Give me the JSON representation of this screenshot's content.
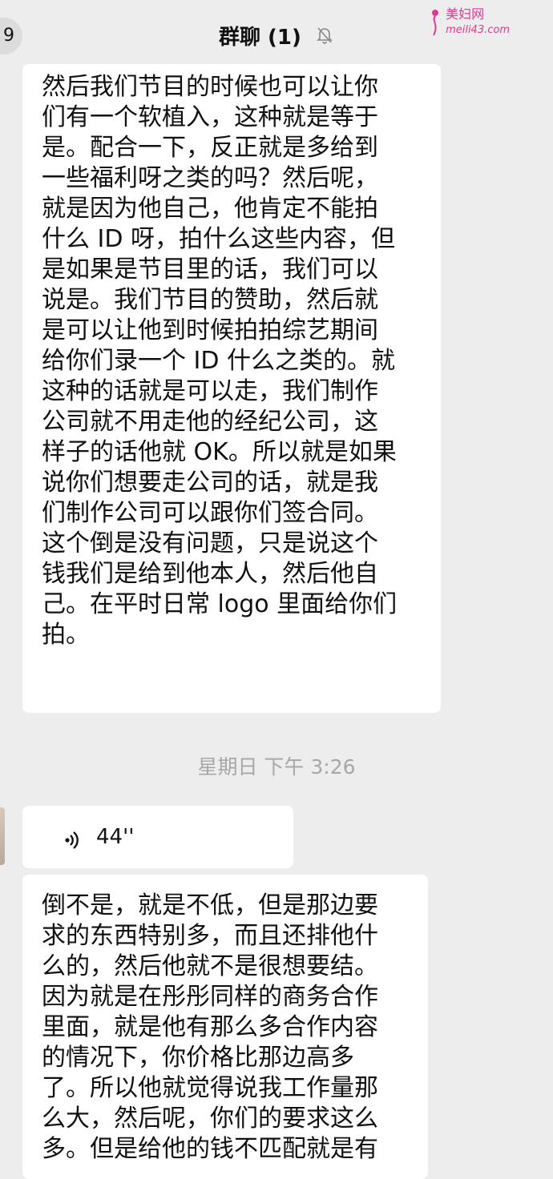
{
  "header": {
    "back_badge": "9",
    "title": "群聊 (1)",
    "mute_icon": "bell-off-icon"
  },
  "watermark": {
    "name": "美妇网",
    "url": "meili43.com"
  },
  "messages": {
    "first_lines": [
      "然后我们节目的时候也可以让你",
      "们有一个软植入，这种就是等于",
      "是。配合一下，反正就是多给到",
      "一些福利呀之类的吗？然后呢，",
      "就是因为他自己，他肯定不能拍",
      "什么 ID 呀，拍什么这些内容，但",
      "是如果是节目里的话，我们可以",
      "说是。我们节目的赞助，然后就",
      "是可以让他到时候拍拍综艺期间",
      "给你们录一个 ID 什么之类的。就",
      "这种的话就是可以走，我们制作",
      "公司就不用走他的经纪公司，这",
      "样子的话他就 OK。所以就是如果",
      "说你们想要走公司的话，就是我",
      "们制作公司可以跟你们签合同。",
      "这个倒是没有问题，只是说这个",
      "钱我们是给到他本人，然后他自",
      "己。在平时日常 logo 里面给你们",
      "拍。"
    ],
    "timestamp": "星期日 下午 3:26",
    "voice": {
      "icon": "voice-wave-icon",
      "duration": "44''"
    },
    "third_lines": [
      "倒不是，就是不低，但是那边要",
      "求的东西特别多，而且还排他什",
      "么的，然后他就不是很想要结。",
      "因为就是在彤彤同样的商务合作",
      "里面，就是他有那么多合作内容",
      "的情况下，你价格比那边高多",
      "了。所以他就觉得说我工作量那",
      "么大，然后呢，你们的要求这么",
      "多。但是给他的钱不匹配就是有"
    ]
  }
}
